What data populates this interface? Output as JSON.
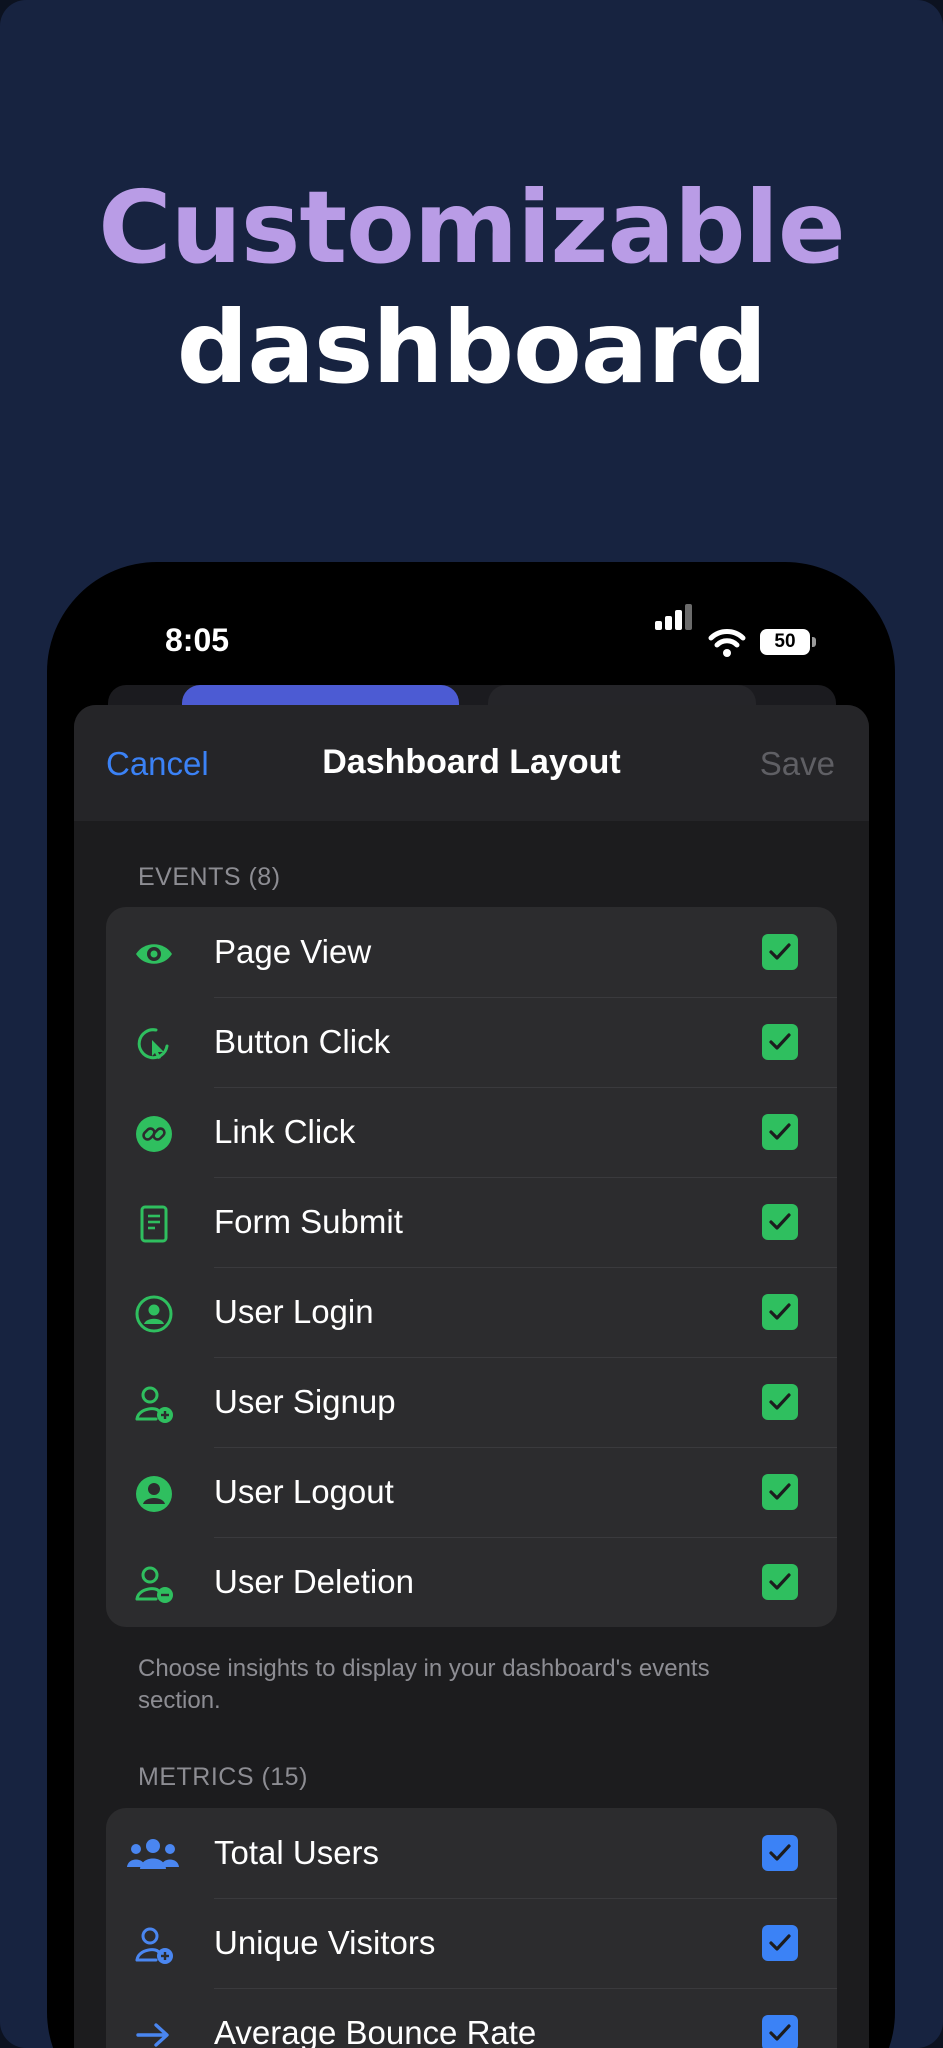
{
  "headline": {
    "line1": "Customizable",
    "line2": "dashboard"
  },
  "status_bar": {
    "time": "8:05",
    "battery": "50"
  },
  "nav": {
    "cancel": "Cancel",
    "title": "Dashboard Layout",
    "save": "Save"
  },
  "colors": {
    "accent": "#3b82f6",
    "event_icon": "#2fbf5f",
    "metric_icon": "#4a86f0",
    "headline_accent": "#b99ce6"
  },
  "events": {
    "header": "EVENTS (8)",
    "items": [
      {
        "label": "Page View",
        "icon": "eye-icon",
        "checked": true
      },
      {
        "label": "Button Click",
        "icon": "cursor-click-icon",
        "checked": true
      },
      {
        "label": "Link Click",
        "icon": "link-icon",
        "checked": true
      },
      {
        "label": "Form Submit",
        "icon": "document-icon",
        "checked": true
      },
      {
        "label": "User Login",
        "icon": "user-circle-icon",
        "checked": true
      },
      {
        "label": "User Signup",
        "icon": "user-plus-icon",
        "checked": true
      },
      {
        "label": "User Logout",
        "icon": "user-solid-icon",
        "checked": true
      },
      {
        "label": "User Deletion",
        "icon": "user-minus-icon",
        "checked": true
      }
    ],
    "footer": "Choose insights to display in your dashboard's events section."
  },
  "metrics": {
    "header": "METRICS (15)",
    "items": [
      {
        "label": "Total Users",
        "icon": "users-group-icon",
        "checked": true
      },
      {
        "label": "Unique Visitors",
        "icon": "user-plus-icon",
        "checked": true
      },
      {
        "label": "Average Bounce Rate",
        "icon": "arrow-right-icon",
        "checked": true
      }
    ]
  }
}
